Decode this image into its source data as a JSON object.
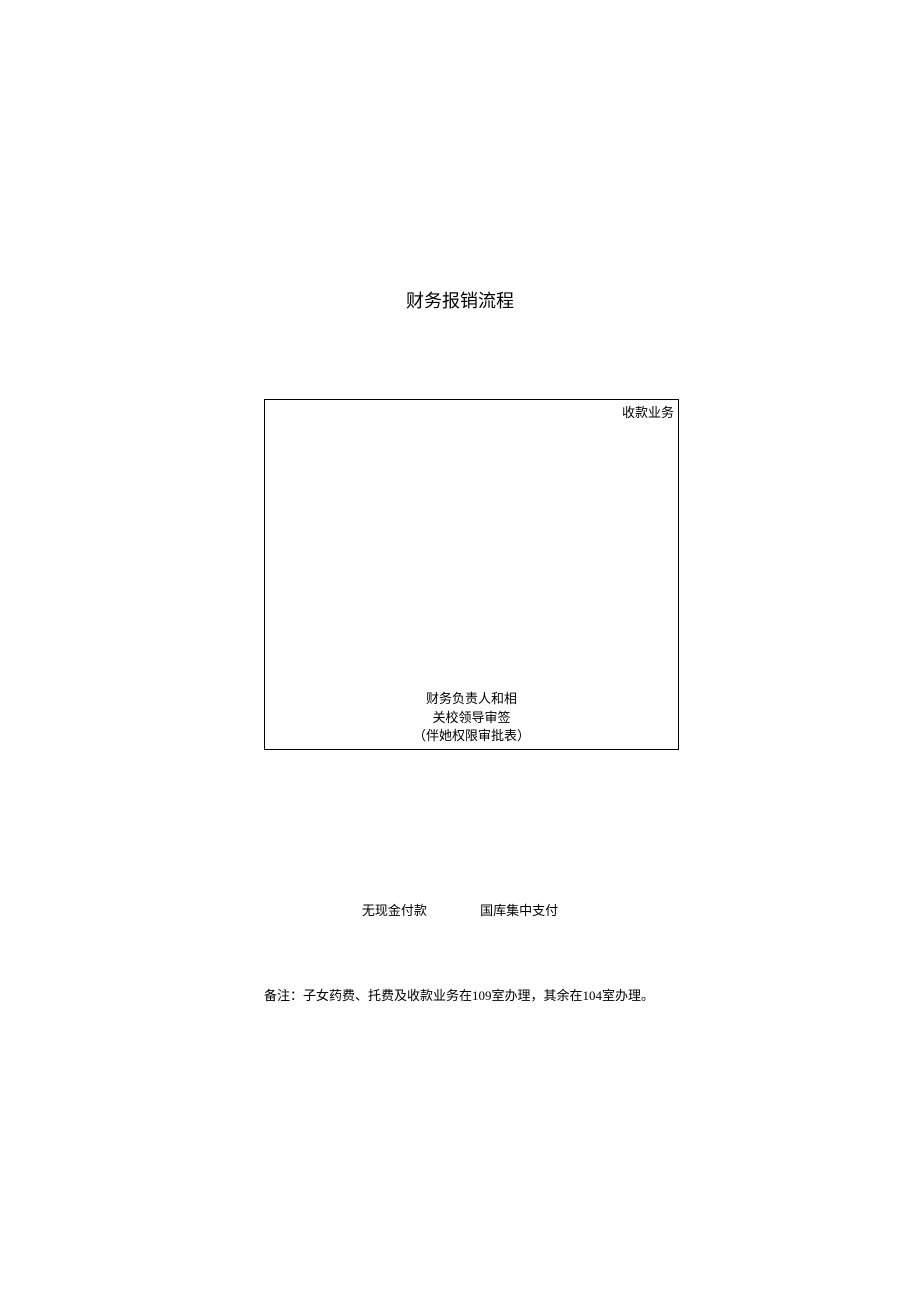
{
  "title": "财务报销流程",
  "box": {
    "topRightLabel": "收款业务",
    "bottomLine1": "财务负责人和相",
    "bottomLine2": "关校领导审签",
    "bottomLine3": "（伴她权限审批表）"
  },
  "payment": {
    "left": "无现金付款",
    "right": "国库集中支付"
  },
  "note": "备注：子女药费、托费及收款业务在109室办理，其余在104室办理。"
}
